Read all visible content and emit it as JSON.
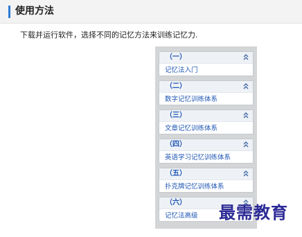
{
  "header": {
    "title": "使用方法",
    "accent_color": "#2f7bd6"
  },
  "instruction": "下载并运行软件，选择不同的记忆方法来训练记忆力.",
  "panel": {
    "cards": [
      {
        "heading": "（一）",
        "label": "记忆法入门",
        "icon": "double-chevron-up-icon"
      },
      {
        "heading": "（二）",
        "label": "数字记忆训练体系",
        "icon": "double-chevron-up-icon"
      },
      {
        "heading": "（三）",
        "label": "文章记忆训练体系",
        "icon": "double-chevron-up-icon"
      },
      {
        "heading": "（四）",
        "label": "英语学习记忆训练体系",
        "icon": "double-chevron-up-icon"
      },
      {
        "heading": "（五）",
        "label": "扑克牌记忆训练体系",
        "icon": "double-chevron-up-icon"
      },
      {
        "heading": "（六）",
        "label": "记忆法高级",
        "icon": "double-chevron-up-icon"
      }
    ]
  },
  "watermark": "最需教育",
  "colors": {
    "link": "#1f56b4",
    "panel_bg": "#d3d5d7",
    "watermark": "#2c2a96"
  }
}
